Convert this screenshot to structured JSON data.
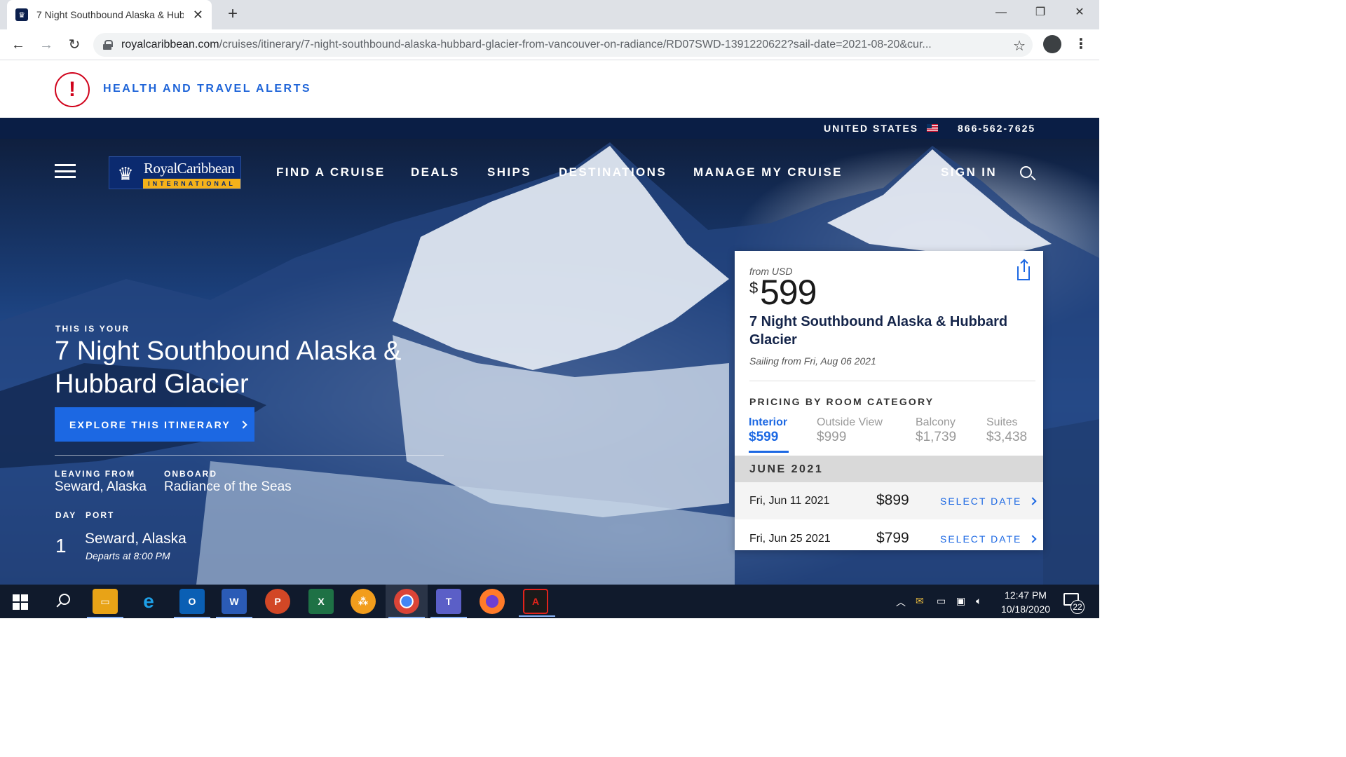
{
  "browser": {
    "tab_title": "7 Night Southbound Alaska & Hubbard Glacier",
    "url_domain": "royalcaribbean.com",
    "url_path": "/cruises/itinerary/7-night-southbound-alaska-hubbard-glacier-from-vancouver-on-radiance/RD07SWD-1391220622?sail-date=2021-08-20&cur..."
  },
  "alert": {
    "text": "HEALTH AND TRAVEL ALERTS"
  },
  "utility": {
    "country": "UNITED STATES",
    "phone": "866-562-7625"
  },
  "logo": {
    "name": "RoyalCaribbean",
    "sub": "INTERNATIONAL"
  },
  "nav": {
    "find_cruise": "FIND A CRUISE",
    "deals": "DEALS",
    "ships": "SHIPS",
    "destinations": "DESTINATIONS",
    "manage": "MANAGE MY CRUISE",
    "sign_in": "SIGN IN"
  },
  "hero": {
    "eyebrow": "THIS IS YOUR",
    "title": "7 Night Southbound Alaska & Hubbard Glacier",
    "explore_btn": "EXPLORE THIS ITINERARY",
    "leaving_label": "LEAVING FROM",
    "leaving_value": "Seward, Alaska",
    "onboard_label": "ONBOARD",
    "onboard_value": "Radiance of the Seas",
    "day_label": "DAY",
    "port_label": "PORT",
    "day_num": "1",
    "port_name": "Seward, Alaska",
    "port_depart": "Departs at 8:00 PM"
  },
  "card": {
    "from": "from USD",
    "currency_symbol": "$",
    "price": "599",
    "title": "7 Night Southbound Alaska & Hubbard Glacier",
    "sailing": "Sailing from Fri, Aug 06 2021",
    "pricing_label": "PRICING BY ROOM CATEGORY",
    "categories": [
      {
        "name": "Interior",
        "price": "$599"
      },
      {
        "name": "Outside View",
        "price": "$999"
      },
      {
        "name": "Balcony",
        "price": "$1,739"
      },
      {
        "name": "Suites",
        "price": "$3,438"
      }
    ],
    "month": "JUNE 2021",
    "dates": [
      {
        "date": "Fri, Jun 11 2021",
        "price": "$899",
        "action": "SELECT DATE"
      },
      {
        "date": "Fri, Jun 25 2021",
        "price": "$799",
        "action": "SELECT DATE"
      }
    ]
  },
  "taskbar": {
    "time": "12:47 PM",
    "date": "10/18/2020",
    "notifications": "22",
    "apps": [
      "file-explorer",
      "internet-explorer",
      "outlook",
      "word",
      "powerpoint",
      "excel",
      "app-orange",
      "chrome",
      "teams",
      "firefox",
      "acrobat"
    ]
  }
}
